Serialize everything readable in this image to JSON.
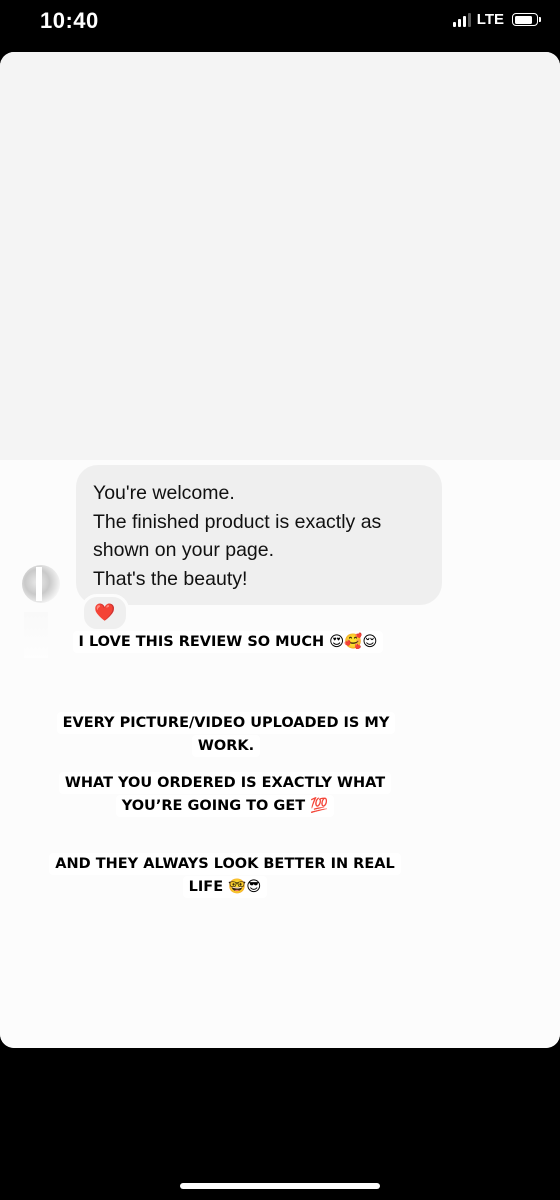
{
  "status_bar": {
    "time": "10:40",
    "network": "LTE",
    "signal_bars_filled": 3,
    "signal_bars_total": 4,
    "battery_level": 0.85
  },
  "message": {
    "lines": [
      "You're welcome.",
      "The finished product is exactly as",
      "shown on your page.",
      "That's the beauty!"
    ],
    "reaction": "❤️",
    "reaction_color": "#e0243b"
  },
  "story_text": {
    "caption_1": "I LOVE THIS REVIEW SO MUCH 😍🥰😌",
    "caption_2": "EVERY PICTURE/VIDEO UPLOADED IS MY WORK.",
    "caption_3": "WHAT YOU ORDERED IS EXACTLY WHAT YOU’RE GOING TO GET 💯",
    "caption_4": "AND THEY ALWAYS LOOK BETTER IN REAL LIFE 🤓😎"
  },
  "colors": {
    "bubble_background": "#efefef",
    "screen_background": "#000000",
    "card_top_background": "#f4f4f4"
  }
}
